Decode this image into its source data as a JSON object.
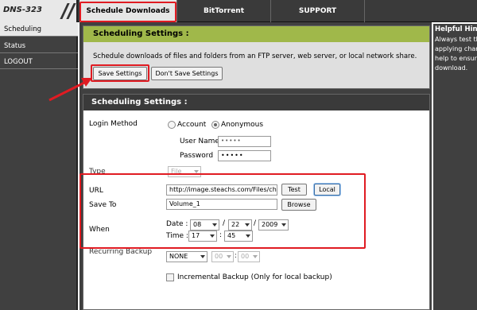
{
  "header": {
    "logo": "DNS-323",
    "tabs": [
      {
        "label": "Schedule Downloads",
        "active": true
      },
      {
        "label": "BitTorrent",
        "active": false
      },
      {
        "label": "SUPPORT",
        "active": false
      }
    ]
  },
  "sidebar": {
    "items": [
      {
        "label": "Scheduling",
        "active": true
      },
      {
        "label": "Status",
        "active": false
      },
      {
        "label": "LOGOUT",
        "active": false
      }
    ]
  },
  "settings_panel": {
    "title": "Scheduling Settings :",
    "description": "Schedule downloads of files and folders from an FTP server, web server, or local network share.",
    "save_label": "Save Settings",
    "dont_save_label": "Don't Save Settings"
  },
  "form": {
    "title": "Scheduling Settings :",
    "login_method_label": "Login Method",
    "account_label": "Account",
    "anonymous_label": "Anonymous",
    "login_method_selected": "Anonymous",
    "username_label": "User Name",
    "username_value": "•••••",
    "password_label": "Password",
    "password_value": "•••••",
    "type_label": "Type",
    "type_value": "File",
    "url_label": "URL",
    "url_value": "http://image.steachs.com/Files/chin",
    "test_label": "Test",
    "local_label": "Local",
    "save_to_label": "Save To",
    "save_to_value": "Volume_1",
    "browse_label": "Browse",
    "when_label": "When",
    "date_label": "Date :",
    "month": "08",
    "day": "22",
    "year": "2009",
    "date_sep": "/",
    "time_label": "Time :",
    "hour": "17",
    "minute": "45",
    "recurring_label": "Recurring Backup",
    "recurring_value": "NONE",
    "rec_hour": "00",
    "rec_min": "00",
    "time_sep": ":",
    "incremental_label": "Incremental Backup (Only for local backup)"
  },
  "help": {
    "title": "Helpful Hints",
    "lines": [
      "Always test the",
      "applying chanc",
      "help to ensure",
      "download."
    ]
  },
  "colors": {
    "accent_green": "#a0b84a",
    "highlight_red": "#e01b22",
    "dark_bg": "#404040"
  }
}
